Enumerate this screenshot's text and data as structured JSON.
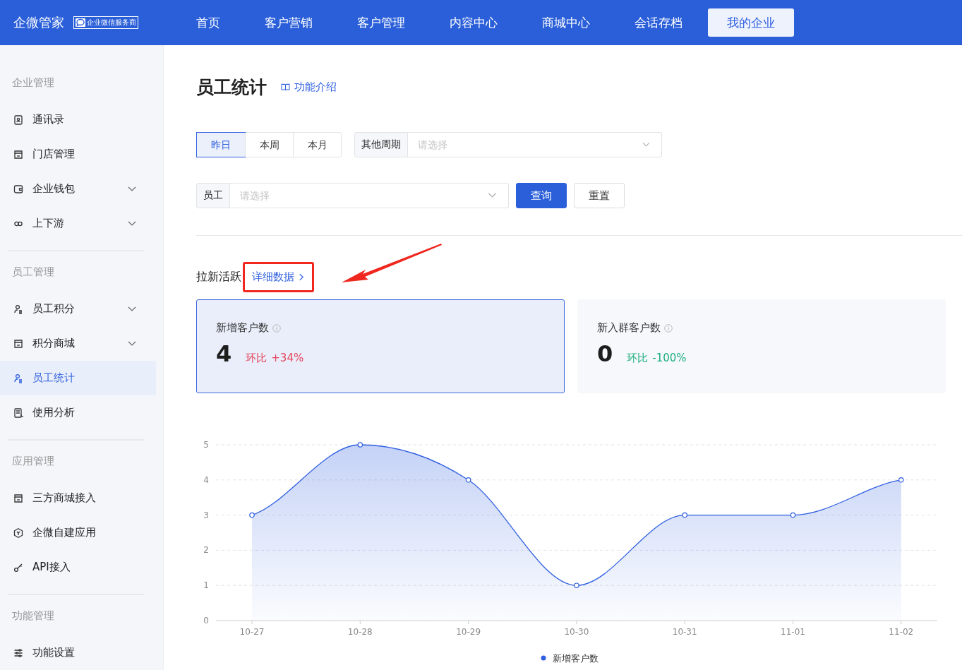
{
  "header": {
    "logo": "企微管家",
    "badge": "企业微信服务商",
    "nav": [
      {
        "label": "首页",
        "selected": false
      },
      {
        "label": "客户营销",
        "selected": false
      },
      {
        "label": "客户管理",
        "selected": false
      },
      {
        "label": "内容中心",
        "selected": false
      },
      {
        "label": "商城中心",
        "selected": false
      },
      {
        "label": "会话存档",
        "selected": false
      },
      {
        "label": "我的企业",
        "selected": true
      }
    ]
  },
  "sidebar": {
    "sections": [
      {
        "title": "企业管理",
        "items": [
          {
            "label": "通讯录",
            "kind": "link",
            "selected": false
          },
          {
            "label": "门店管理",
            "kind": "link",
            "selected": false
          },
          {
            "label": "企业钱包",
            "kind": "group",
            "expanded": false,
            "selected": false
          },
          {
            "label": "上下游",
            "kind": "group",
            "expanded": false,
            "selected": false
          }
        ]
      },
      {
        "title": "员工管理",
        "items": [
          {
            "label": "员工积分",
            "kind": "group",
            "expanded": false,
            "selected": false
          },
          {
            "label": "积分商城",
            "kind": "group",
            "expanded": false,
            "selected": false
          },
          {
            "label": "员工统计",
            "kind": "link",
            "selected": true
          },
          {
            "label": "使用分析",
            "kind": "link",
            "selected": false
          }
        ]
      },
      {
        "title": "应用管理",
        "items": [
          {
            "label": "三方商城接入",
            "kind": "link",
            "selected": false
          },
          {
            "label": "企微自建应用",
            "kind": "link",
            "selected": false
          },
          {
            "label": "API接入",
            "kind": "link",
            "selected": false
          }
        ]
      },
      {
        "title": "功能管理",
        "items": [
          {
            "label": "功能设置",
            "kind": "link",
            "selected": false
          }
        ]
      }
    ]
  },
  "page": {
    "title": "员工统计",
    "help_link": "功能介绍",
    "periods": [
      {
        "label": "昨日",
        "selected": true
      },
      {
        "label": "本周",
        "selected": false
      },
      {
        "label": "本月",
        "selected": false
      }
    ],
    "other_period": {
      "label": "其他周期",
      "placeholder": "请选择"
    },
    "employee": {
      "label": "员工",
      "placeholder": "请选择"
    },
    "buttons": [
      {
        "label": "查询",
        "kind": "primary"
      },
      {
        "label": "重置",
        "kind": "default"
      }
    ],
    "section_title": "拉新活跃",
    "detail_link": "详细数据",
    "cards": [
      {
        "label": "新增客户数",
        "value": "4",
        "compare_label": "环比",
        "change": "+34%",
        "kind": "increase",
        "selected": true
      },
      {
        "label": "新入群客户数",
        "value": "0",
        "compare_label": "环比",
        "change": "-100%",
        "kind": "decrease",
        "selected": false
      }
    ],
    "chart_data": {
      "type": "area",
      "categories": [
        "10-27",
        "10-28",
        "10-29",
        "10-30",
        "10-31",
        "11-01",
        "11-02"
      ],
      "series": [
        {
          "name": "新增客户数",
          "color": "#2f5fe0",
          "values": [
            3,
            5,
            4,
            1,
            3,
            3,
            4
          ]
        }
      ],
      "ylim": [
        0,
        5
      ],
      "yticks": [
        0,
        1,
        2,
        3,
        4,
        5
      ],
      "grid": true
    }
  }
}
